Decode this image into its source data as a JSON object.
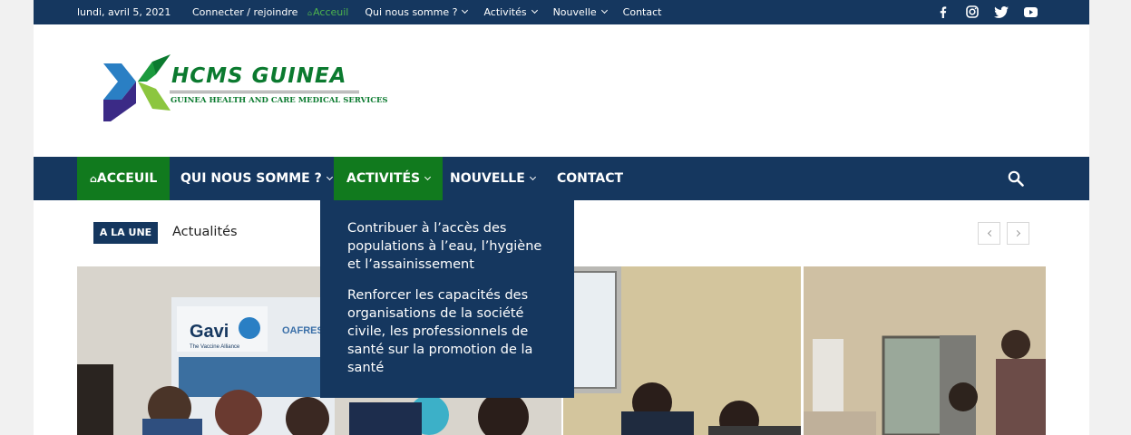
{
  "topbar": {
    "date": "lundi, avril 5, 2021",
    "login": "Connecter / rejoindre",
    "menu": [
      {
        "label": "Acceuil",
        "active": true,
        "dropdown": false
      },
      {
        "label": "Qui nous somme ?",
        "active": false,
        "dropdown": true
      },
      {
        "label": "Activités",
        "active": false,
        "dropdown": true
      },
      {
        "label": "Nouvelle",
        "active": false,
        "dropdown": true
      },
      {
        "label": "Contact",
        "active": false,
        "dropdown": false
      }
    ],
    "socials": [
      "facebook-icon",
      "instagram-icon",
      "twitter-icon",
      "youtube-icon"
    ]
  },
  "logo": {
    "title": "HCMS GUINEA",
    "subtitle": "GUINEA HEALTH AND CARE MEDICAL SERVICES"
  },
  "nav": {
    "items": [
      {
        "label": "ACCEUIL",
        "icon": "home-icon"
      },
      {
        "label": "QUI NOUS SOMME ?"
      },
      {
        "label": "ACTIVITÉS"
      },
      {
        "label": "NOUVELLE"
      },
      {
        "label": "CONTACT"
      }
    ],
    "search_icon": "search-icon"
  },
  "dropdown": {
    "items": [
      "Contribuer à l’accès des populations à l’eau, l’hygiène et l’assainissement",
      "Renforcer les capacités des organisations de la société civile, les professionnels de santé sur la promotion de la santé"
    ]
  },
  "ticker": {
    "badge": "A LA UNE",
    "text": "Actualités"
  },
  "photos": {
    "banner_text": "Gavi",
    "banner_sub": "The Vaccine Alliance",
    "banner_org": "OAFRESS"
  },
  "colors": {
    "navy": "#15375f",
    "green": "#117a1e",
    "active_link": "#4db34d"
  }
}
